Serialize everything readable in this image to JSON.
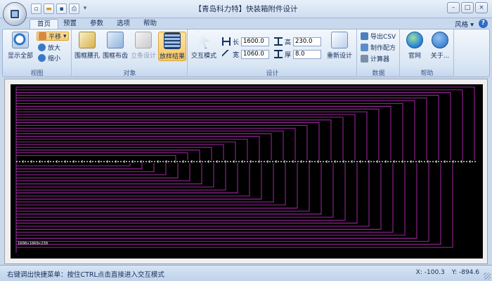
{
  "window": {
    "title": "【青岛科力特】快装箱附件设计",
    "minimize_glyph": "–",
    "maximize_glyph": "□",
    "close_glyph": "×"
  },
  "quick_access": {
    "icons": [
      "new-file-icon",
      "open-folder-icon",
      "save-icon",
      "print-icon"
    ],
    "customize_glyph": "▾"
  },
  "tabs": [
    {
      "label": "首页",
      "active": true
    },
    {
      "label": "预置",
      "active": false
    },
    {
      "label": "参数",
      "active": false
    },
    {
      "label": "选项",
      "active": false
    },
    {
      "label": "帮助",
      "active": false
    }
  ],
  "style_menu": {
    "label": "风格",
    "arrow": "▾"
  },
  "help_button": {
    "glyph": "?"
  },
  "ribbon": {
    "view": {
      "label": "视图",
      "show_all": "显示全部",
      "pan": "平移",
      "pan_arrow": "▾",
      "zoom_in": "放大",
      "zoom_out": "缩小"
    },
    "objects": {
      "label": "对象",
      "frame_waist_hole": "围框腰孔",
      "frame_tooth": "围框布齿",
      "post_design": "立条设计",
      "layout_result": "放样结果"
    },
    "design": {
      "label": "设计",
      "interactive_mode": "交互模式",
      "length_label": "长",
      "length_value": "1600.0",
      "width_label": "宽",
      "width_value": "1060.0",
      "height_label": "高",
      "height_value": "230.0",
      "thickness_label": "厚",
      "thickness_value": "8.0",
      "redesign": "重新设计"
    },
    "data": {
      "label": "数据",
      "export_csv": "导出CSV",
      "make_formula": "制作配方",
      "calculator": "计算器"
    },
    "help": {
      "label": "帮助",
      "website": "官网",
      "about": "关于..."
    }
  },
  "drawing": {
    "background": "#000000",
    "line_color": "#cc33cc",
    "center_color": "#ffffff",
    "caption": "1600×1060×230"
  },
  "status": {
    "hint": "右键调出快捷菜单：按住CTRL点击直接进入交互模式",
    "x_label": "X:",
    "x_value": "-100.3",
    "y_label": "Y:",
    "y_value": "-894.6"
  },
  "colors": {
    "accent": "#fbc863",
    "ribbon_bg": "#dbe7f5"
  }
}
